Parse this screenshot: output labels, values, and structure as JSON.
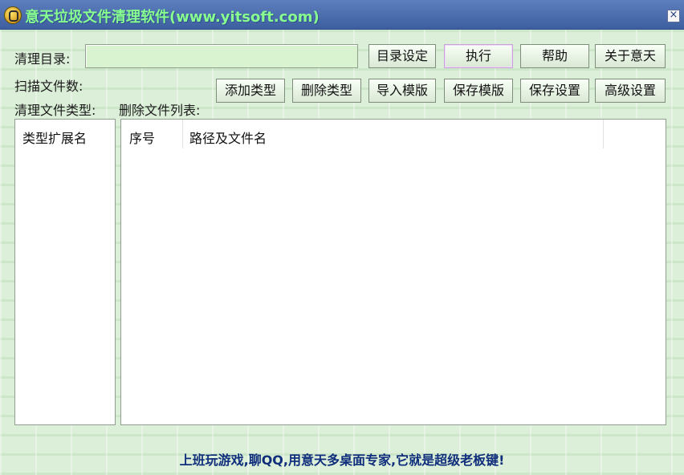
{
  "title": "意天垃圾文件清理软件(www.yitsoft.com)",
  "labels": {
    "dir": "清理目录:",
    "scan_count": "扫描文件数:",
    "types": "清理文件类型:",
    "delete_list": "删除文件列表:"
  },
  "inputs": {
    "dir_value": ""
  },
  "buttons": {
    "set_dir": "目录设定",
    "execute": "执行",
    "help": "帮助",
    "about": "关于意天",
    "add_type": "添加类型",
    "remove_type": "删除类型",
    "import_template": "导入模版",
    "save_template": "保存模版",
    "save_settings": "保存设置",
    "advanced": "高级设置"
  },
  "left_table": {
    "header": "类型扩展名"
  },
  "right_table": {
    "headers": [
      "序号",
      "路径及文件名"
    ]
  },
  "status": "上班玩游戏,聊QQ,用意天多桌面专家,它就是超级老板键!"
}
